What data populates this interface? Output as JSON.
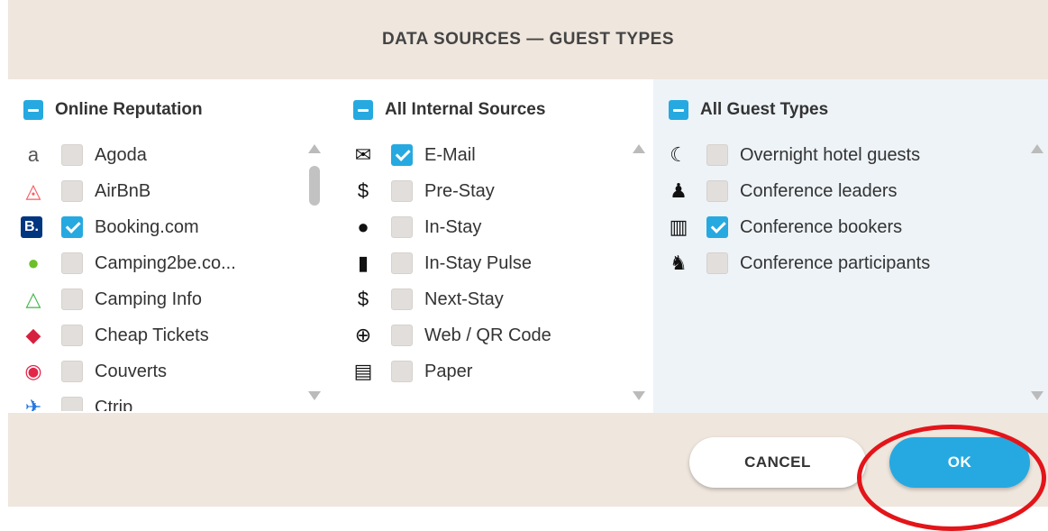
{
  "dialog": {
    "title": "DATA SOURCES — GUEST TYPES"
  },
  "columns": [
    {
      "header": "Online Reputation",
      "items": [
        {
          "icon": "agoda-icon",
          "glyph": "a",
          "color": "#555555",
          "label": "Agoda",
          "checked": false
        },
        {
          "icon": "airbnb-icon",
          "glyph": "◬",
          "color": "#ff5a5f",
          "label": "AirBnB",
          "checked": false
        },
        {
          "icon": "booking-icon",
          "glyph": "B.",
          "color": "#003580",
          "label": "Booking.com",
          "checked": true
        },
        {
          "icon": "camping2be-icon",
          "glyph": "●",
          "color": "#6cbf2a",
          "label": "Camping2be.co...",
          "checked": false
        },
        {
          "icon": "camping-info-icon",
          "glyph": "△",
          "color": "#41b649",
          "label": "Camping Info",
          "checked": false
        },
        {
          "icon": "cheap-tickets-icon",
          "glyph": "◆",
          "color": "#d6203f",
          "label": "Cheap Tickets",
          "checked": false
        },
        {
          "icon": "couverts-icon",
          "glyph": "◉",
          "color": "#e2264a",
          "label": "Couverts",
          "checked": false
        },
        {
          "icon": "ctrip-icon",
          "glyph": "✈",
          "color": "#2577e3",
          "label": "Ctrip",
          "checked": false
        }
      ]
    },
    {
      "header": "All Internal Sources",
      "items": [
        {
          "icon": "email-icon",
          "glyph": "✉",
          "color": "#111111",
          "label": "E-Mail",
          "checked": true
        },
        {
          "icon": "dollar-icon",
          "glyph": "$",
          "color": "#111111",
          "label": "Pre-Stay",
          "checked": false
        },
        {
          "icon": "speech-bubble-icon",
          "glyph": "●",
          "color": "#111111",
          "label": "In-Stay",
          "checked": false
        },
        {
          "icon": "pulse-icon",
          "glyph": "▮",
          "color": "#111111",
          "label": "In-Stay Pulse",
          "checked": false
        },
        {
          "icon": "dollar-icon",
          "glyph": "$",
          "color": "#111111",
          "label": "Next-Stay",
          "checked": false
        },
        {
          "icon": "globe-icon",
          "glyph": "⊕",
          "color": "#111111",
          "label": "Web / QR Code",
          "checked": false
        },
        {
          "icon": "document-icon",
          "glyph": "▤",
          "color": "#111111",
          "label": "Paper",
          "checked": false
        }
      ]
    },
    {
      "header": "All Guest Types",
      "items": [
        {
          "icon": "moon-icon",
          "glyph": "☾",
          "color": "#111111",
          "label": "Overnight hotel guests",
          "checked": false
        },
        {
          "icon": "leader-icon",
          "glyph": "♟",
          "color": "#111111",
          "label": "Conference leaders",
          "checked": false
        },
        {
          "icon": "book-icon",
          "glyph": "▥",
          "color": "#111111",
          "label": "Conference bookers",
          "checked": true
        },
        {
          "icon": "group-icon",
          "glyph": "♞",
          "color": "#111111",
          "label": "Conference participants",
          "checked": false
        }
      ]
    }
  ],
  "buttons": {
    "cancel": "CANCEL",
    "ok": "OK"
  },
  "colors": {
    "accent": "#26a9e0",
    "header_bg": "#efe6dd",
    "highlight_ring": "#e3151a"
  }
}
